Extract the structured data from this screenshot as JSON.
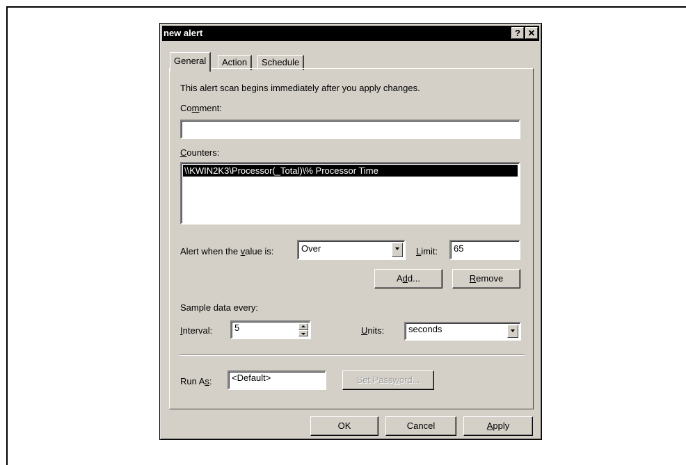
{
  "dialog": {
    "title": "new alert",
    "help_label": "?",
    "close_label": "✕"
  },
  "tabs": [
    {
      "label": "General",
      "active": true
    },
    {
      "label": "Action",
      "active": false
    },
    {
      "label": "Schedule",
      "active": false
    }
  ],
  "general": {
    "intro_text": "This alert scan begins immediately after you apply changes.",
    "comment_label_pre": "Co",
    "comment_label_ul": "m",
    "comment_label_post": "ment:",
    "comment_value": "",
    "counters_label_ul": "C",
    "counters_label_post": "ounters:",
    "counters": [
      "\\\\KWIN2K3\\Processor(_Total)\\% Processor Time"
    ],
    "alert_label_pre": "Alert when the ",
    "alert_label_ul": "v",
    "alert_label_post": "alue is:",
    "alert_condition": "Over",
    "limit_label_ul": "L",
    "limit_label_post": "imit:",
    "limit_value": "65",
    "add_button_pre": "A",
    "add_button_ul": "d",
    "add_button_post": "d...",
    "remove_button_ul": "R",
    "remove_button_post": "emove",
    "sample_label": "Sample data every:",
    "interval_label_ul": "I",
    "interval_label_post": "nterval:",
    "interval_value": "5",
    "units_label_ul": "U",
    "units_label_post": "nits:",
    "units_value": "seconds",
    "runas_label_pre": "Run A",
    "runas_label_ul": "s",
    "runas_label_post": ":",
    "runas_value": "<Default>",
    "set_password_pre": "Set Pass",
    "set_password_ul": "w",
    "set_password_post": "ord..."
  },
  "footer": {
    "ok_label": "OK",
    "cancel_label": "Cancel",
    "apply_label_ul": "A",
    "apply_label_post": "pply"
  }
}
